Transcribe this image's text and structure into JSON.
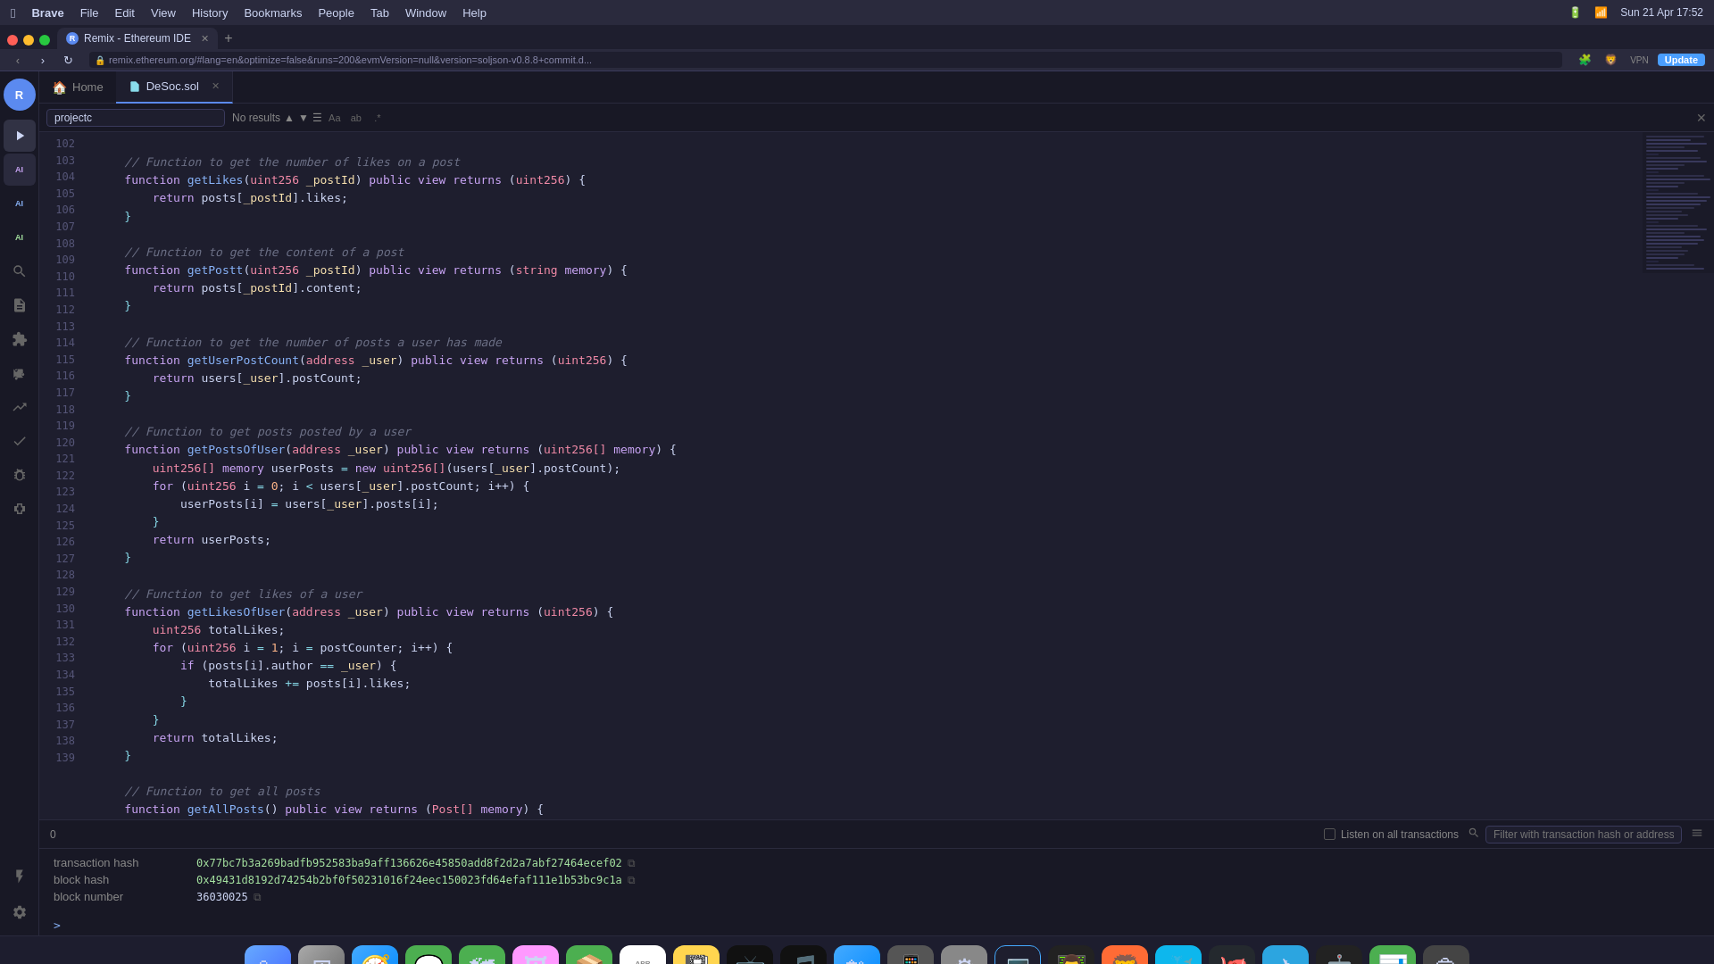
{
  "macos": {
    "apple": "&#63743;",
    "app_name": "Brave",
    "menus": [
      "File",
      "Edit",
      "View",
      "History",
      "Bookmarks",
      "People",
      "Tab",
      "Window",
      "Help"
    ],
    "right_items": [
      "wifi_icon",
      "bluetooth_icon",
      "battery_icon",
      "time"
    ],
    "time": "Sun 21 Apr  17:52"
  },
  "browser": {
    "tab_title": "Remix - Ethereum IDE",
    "tab_favicon": "R",
    "url": "remix.ethereum.org/#lang=en&optimize=false&runs=200&evmVersion=null&version=soljson-v0.8.8+commit.d...",
    "update_label": "Update"
  },
  "editor": {
    "search_placeholder": "projectc",
    "search_result": "No results",
    "home_tab": "Home",
    "file_tab": "DeSoc.sol",
    "lines": [
      {
        "num": "102",
        "content": ""
      },
      {
        "num": "103",
        "content": "    // Function to get the number of likes on a post",
        "type": "comment"
      },
      {
        "num": "104",
        "content": "    function getLikes(uint256 _postId) public view returns (uint256) {",
        "type": "code"
      },
      {
        "num": "105",
        "content": "        return posts[_postId].likes;",
        "type": "code"
      },
      {
        "num": "106",
        "content": "    }",
        "type": "code"
      },
      {
        "num": "107",
        "content": ""
      },
      {
        "num": "108",
        "content": "    // Function to get the content of a post",
        "type": "comment"
      },
      {
        "num": "109",
        "content": "    function getPostt(uint256 _postId) public view returns (string memory) {",
        "type": "code"
      },
      {
        "num": "110",
        "content": "        return posts[_postId].content;",
        "type": "code"
      },
      {
        "num": "111",
        "content": "    }",
        "type": "code"
      },
      {
        "num": "112",
        "content": ""
      },
      {
        "num": "113",
        "content": "    // Function to get the number of posts a user has made",
        "type": "comment"
      },
      {
        "num": "114",
        "content": "    function getUserPostCount(address _user) public view returns (uint256) {",
        "type": "code"
      },
      {
        "num": "115",
        "content": "        return users[_user].postCount;",
        "type": "code"
      },
      {
        "num": "116",
        "content": "    }",
        "type": "code"
      },
      {
        "num": "117",
        "content": ""
      },
      {
        "num": "118",
        "content": "    // Function to get posts posted by a user",
        "type": "comment"
      },
      {
        "num": "119",
        "content": "    function getPostsOfUser(address _user) public view returns (uint256[] memory) {",
        "type": "code"
      },
      {
        "num": "120",
        "content": "        uint256[] memory userPosts = new uint256[](users[_user].postCount);",
        "type": "code"
      },
      {
        "num": "121",
        "content": "        for (uint256 i = 0; i < users[_user].postCount; i++) {",
        "type": "code"
      },
      {
        "num": "122",
        "content": "            userPosts[i] = users[_user].posts[i];",
        "type": "code"
      },
      {
        "num": "123",
        "content": "        }",
        "type": "code"
      },
      {
        "num": "124",
        "content": "        return userPosts;",
        "type": "code"
      },
      {
        "num": "125",
        "content": "    }",
        "type": "code"
      },
      {
        "num": "126",
        "content": ""
      },
      {
        "num": "127",
        "content": "    // Function to get likes of a user",
        "type": "comment"
      },
      {
        "num": "128",
        "content": "    function getLikesOfUser(address _user) public view returns (uint256) {",
        "type": "code"
      },
      {
        "num": "129",
        "content": "        uint256 totalLikes;",
        "type": "code"
      },
      {
        "num": "130",
        "content": "        for (uint256 i = 1; i = postCounter; i++) {",
        "type": "code"
      },
      {
        "num": "131",
        "content": "            if (posts[i].author == _user) {",
        "type": "code"
      },
      {
        "num": "132",
        "content": "                totalLikes += posts[i].likes;",
        "type": "code"
      },
      {
        "num": "133",
        "content": "            }",
        "type": "code"
      },
      {
        "num": "134",
        "content": "        }",
        "type": "code"
      },
      {
        "num": "135",
        "content": "        return totalLikes;",
        "type": "code"
      },
      {
        "num": "136",
        "content": "    }",
        "type": "code"
      },
      {
        "num": "137",
        "content": ""
      },
      {
        "num": "138",
        "content": "    // Function to get all posts",
        "type": "comment"
      },
      {
        "num": "139",
        "content": "    function getAllPosts() public view returns (Post[] memory) {",
        "type": "code"
      }
    ]
  },
  "bottom_panel": {
    "count": "0",
    "listen_label": "Listen on all transactions",
    "filter_placeholder": "Filter with transaction hash or address",
    "tx_hash_label": "transaction hash",
    "tx_hash_value": "0x77bc7b3a269badfb952583ba9aff136626e45850add8f2d2a7abf27464ecef02",
    "block_hash_label": "block hash",
    "block_hash_value": "0x49431d8192d74254b2bf0f50231016f24eec150023fd64efaf111e1b53bc9c1a",
    "block_number_label": "block number",
    "block_number_value": "36030025",
    "terminal_prompt": ">"
  },
  "sidebar_icons": {
    "logo": "R",
    "run": "▶",
    "ai1": "AI",
    "ai2": "AI",
    "ai3": "AI",
    "search": "🔍",
    "file": "📄",
    "plugin": "🔌",
    "git": "⑂",
    "chart": "📊",
    "check": "✓",
    "debug": "🐛",
    "extension": "⊞",
    "bottom1": "⚡",
    "bottom2": "⚙"
  },
  "dock": {
    "items": [
      "🍎",
      "🗂",
      "🧭",
      "💬",
      "🗺",
      "🖼",
      "📦",
      "📅",
      "📓",
      "📺",
      "🎵",
      "🛍",
      "📱",
      "⚙",
      "💻",
      "👨‍💻",
      "🦁",
      "🐳",
      "🐙",
      "✈",
      "🤖",
      "📊",
      "🗑"
    ]
  }
}
